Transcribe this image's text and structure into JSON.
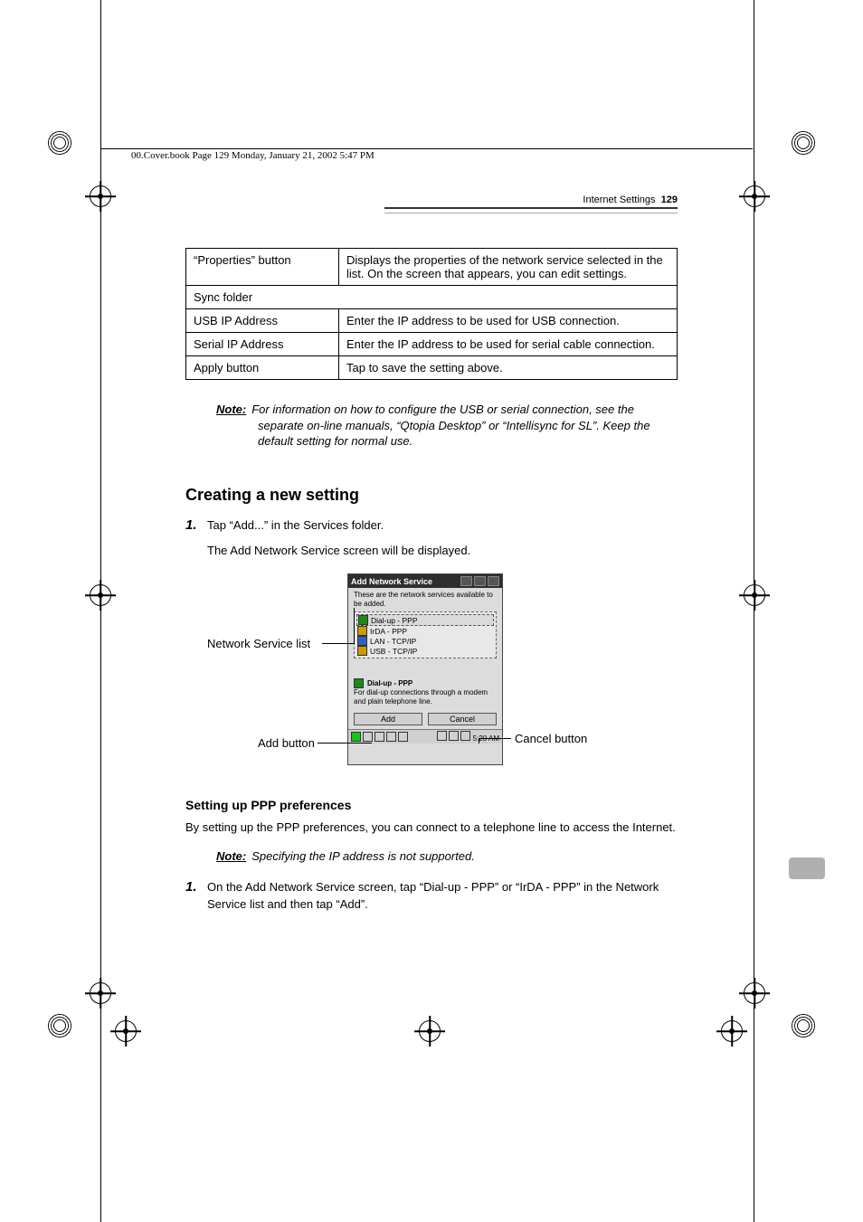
{
  "file_path": "00.Cover.book  Page 129  Monday, January 21, 2002  5:47 PM",
  "header": {
    "section": "Internet Settings",
    "page": "129"
  },
  "table": {
    "rows": [
      {
        "c1": "“Properties” button",
        "c2": "Displays the properties of the network service selected in the list. On the screen that appears, you can edit settings."
      },
      {
        "c1": "Sync folder",
        "c2": "",
        "span": true
      },
      {
        "c1": "USB IP Address",
        "c2": "Enter the IP address to be used for USB connection."
      },
      {
        "c1": "Serial IP Address",
        "c2": "Enter the IP address to be used for serial cable connection."
      },
      {
        "c1": "Apply button",
        "c2": "Tap to save the setting above."
      }
    ]
  },
  "note1": {
    "label": "Note:",
    "text": "For information on how to configure the USB or serial connection, see the separate on-line manuals, “Qtopia Desktop” or “Intellisync for SL”. Keep the default setting for normal use."
  },
  "heading1": "Creating a new setting",
  "step1": {
    "num": "1.",
    "line1": "Tap “Add...” in the Services folder.",
    "line2": "The Add Network Service screen will be displayed."
  },
  "figure": {
    "label_service_list": "Network Service list",
    "label_add": "Add button",
    "label_cancel": "Cancel button",
    "device": {
      "title": "Add Network Service",
      "desc": "These are the network services available to be added.",
      "items": [
        "Dial-up - PPP",
        "IrDA - PPP",
        "LAN - TCP/IP",
        "USB - TCP/IP"
      ],
      "selected_title": "Dial-up - PPP",
      "selected_desc": "For dial-up connections through a modem and plain telephone line.",
      "btn_add": "Add",
      "btn_cancel": "Cancel",
      "time": "5:20 AM"
    }
  },
  "heading2": "Setting up PPP preferences",
  "para1": "By setting up the PPP preferences, you can connect to a telephone line to access the Internet.",
  "note2": {
    "label": "Note:",
    "text": "Specifying the IP address is not supported."
  },
  "step2": {
    "num": "1.",
    "text": "On the Add Network Service screen, tap “Dial-up - PPP” or  “IrDA - PPP” in the Network Service list and then tap “Add”."
  }
}
